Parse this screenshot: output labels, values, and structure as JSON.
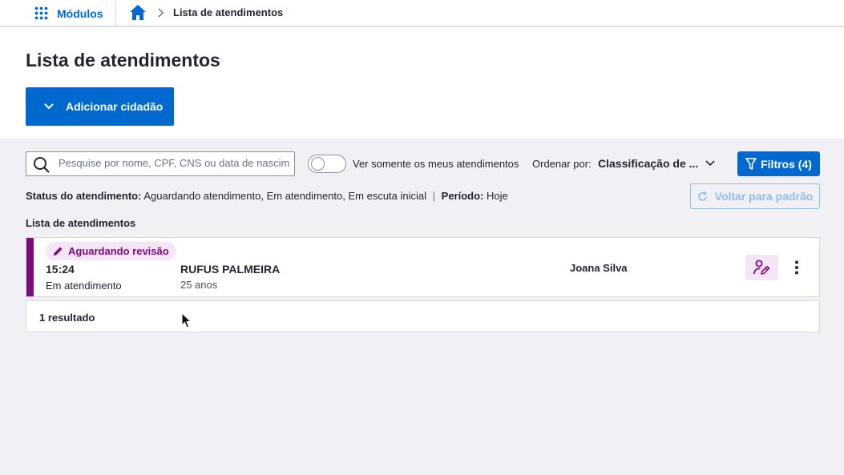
{
  "topbar": {
    "modules_label": "Módulos",
    "breadcrumb_current": "Lista de atendimentos"
  },
  "header": {
    "title": "Lista de atendimentos",
    "add_button_label": "Adicionar cidadão"
  },
  "toolbar": {
    "search_placeholder": "Pesquise por nome, CPF, CNS ou data de nascimento",
    "search_value": "",
    "toggle_label": "Ver somente os meus atendimentos",
    "toggle_on": false,
    "order_label": "Ordenar por:",
    "order_value": "Classificação de ...",
    "filters_button": "Filtros (4)"
  },
  "status": {
    "status_label": "Status do atendimento:",
    "status_value": "Aguardando atendimento, Em atendimento, Em escuta inicial",
    "separator": "|",
    "period_label": "Período:",
    "period_value": "Hoje",
    "reset_button": "Voltar para padrão"
  },
  "list": {
    "title": "Lista de atendimentos",
    "items": [
      {
        "badge": "Aguardando revisão",
        "time": "15:24",
        "state": "Em atendimento",
        "name": "RUFUS PALMEIRA",
        "age": "25 anos",
        "professional": "Joana Silva"
      }
    ],
    "results_count": "1 resultado"
  },
  "colors": {
    "primary": "#0069d0",
    "review_purple": "#7f0a7f",
    "review_bg": "#f5e6f5",
    "page_bg": "#f0f0f5"
  }
}
